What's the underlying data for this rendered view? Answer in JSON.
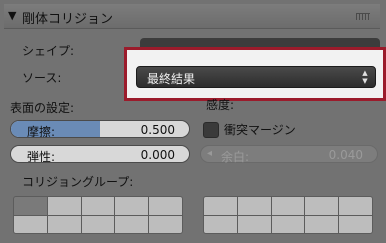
{
  "panel": {
    "title": "剛体コリジョン",
    "shape_label": "シェイプ:",
    "source_label": "ソース:",
    "source_value": "最終結果",
    "surface_label": "表面の設定:",
    "sensitivity_label": "感度:",
    "friction": {
      "label": "摩擦:",
      "value": "0.500",
      "fraction": 0.5
    },
    "bounciness": {
      "label": "弾性:",
      "value": "0.000",
      "fraction": 0.0
    },
    "margin_checkbox_label": "衝突マージン",
    "margin": {
      "label": "余白:",
      "value": "0.040"
    },
    "collision_groups_label": "コリジョングループ:",
    "group_left_active": [
      0
    ],
    "accent_color": "#9b1b2b"
  }
}
